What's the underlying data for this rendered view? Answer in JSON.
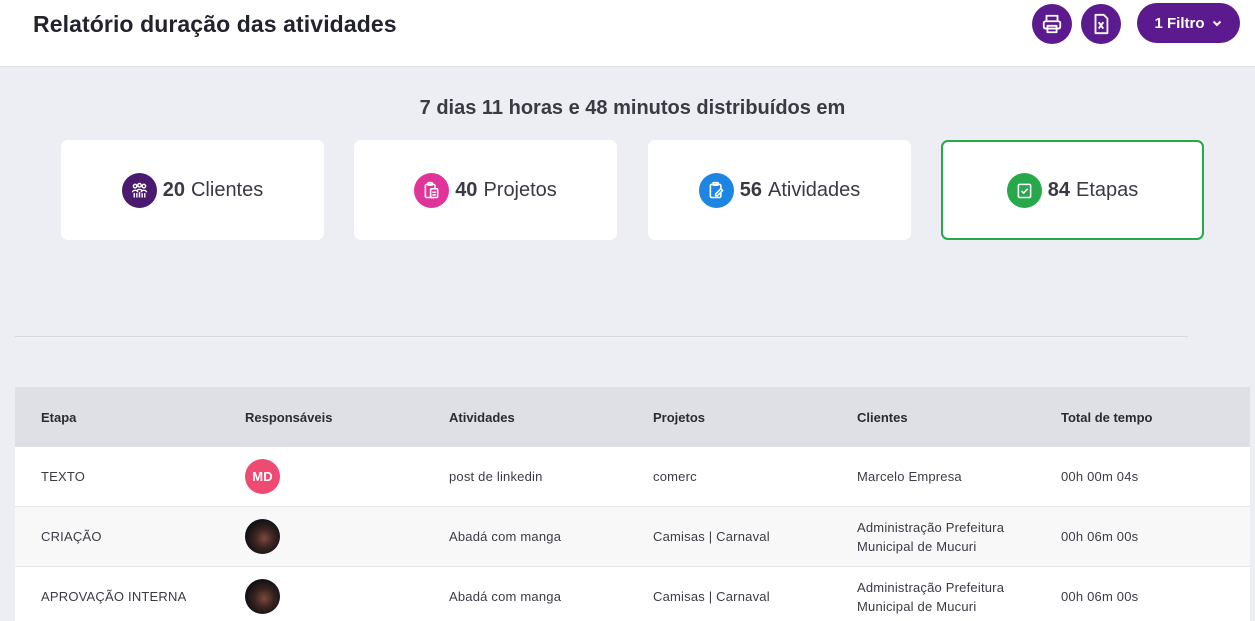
{
  "header": {
    "title": "Relatório duração das atividades",
    "filter_label": "1 Filtro"
  },
  "summary": "7 dias 11 horas e 48 minutos distribuídos em",
  "cards": {
    "clientes": {
      "count": "20",
      "label": "Clientes",
      "color": "#4a1a6e"
    },
    "projetos": {
      "count": "40",
      "label": "Projetos",
      "color": "#e0349a"
    },
    "atividades": {
      "count": "56",
      "label": "Atividades",
      "color": "#1e86e0"
    },
    "etapas": {
      "count": "84",
      "label": "Etapas",
      "color": "#27a84a"
    }
  },
  "table": {
    "columns": [
      "Etapa",
      "Responsáveis",
      "Atividades",
      "Projetos",
      "Clientes",
      "Total de tempo"
    ],
    "rows": [
      {
        "etapa": "TEXTO",
        "responsavel": "MD",
        "atividade": "post de linkedin",
        "projeto": "comerc",
        "cliente_l1": "Marcelo Empresa",
        "cliente_l2": "",
        "tempo": "00h 00m 04s"
      },
      {
        "etapa": "CRIAÇÃO",
        "responsavel": "",
        "atividade": "Abadá com manga",
        "projeto": "Camisas | Carnaval",
        "cliente_l1": "Administração Prefeitura",
        "cliente_l2": "Municipal de Mucuri",
        "tempo": "00h 06m 00s"
      },
      {
        "etapa": "APROVAÇÃO INTERNA",
        "responsavel": "",
        "atividade": "Abadá com manga",
        "projeto": "Camisas | Carnaval",
        "cliente_l1": "Administração Prefeitura",
        "cliente_l2": "Municipal de Mucuri",
        "tempo": "00h 06m 00s"
      }
    ]
  },
  "colors": {
    "brand": "#5c1a8f",
    "accent_green": "#27a84a",
    "avatar_md": "#ef4a72"
  }
}
